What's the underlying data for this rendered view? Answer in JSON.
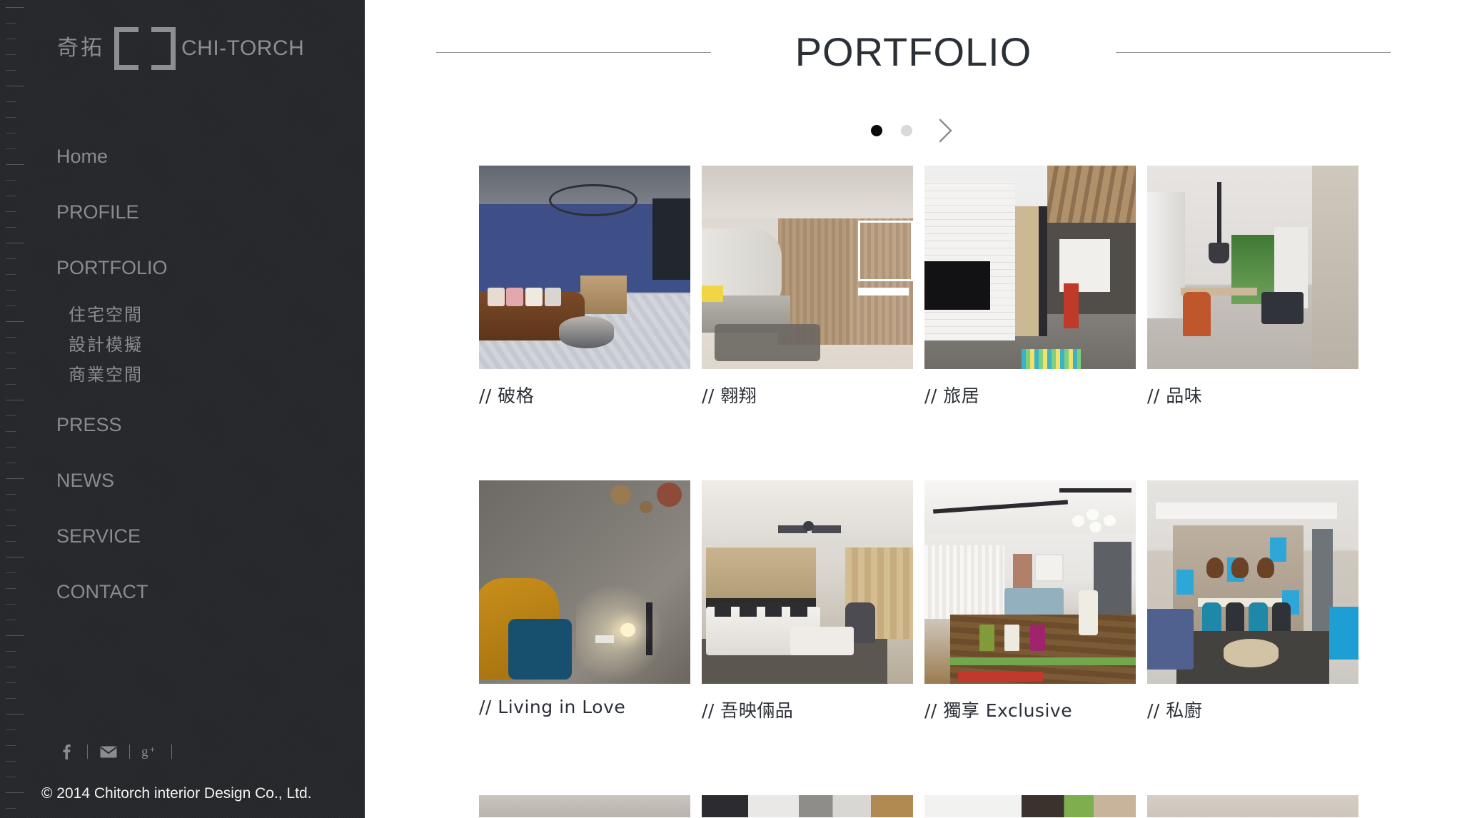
{
  "sidebar": {
    "logo": {
      "cn": "奇拓",
      "en": "CHI-TORCH",
      "bracket_icon": "bracket-logo-icon"
    },
    "nav": [
      {
        "label": "Home",
        "name": "home"
      },
      {
        "label": "PROFILE",
        "name": "profile"
      },
      {
        "label": "PORTFOLIO",
        "name": "portfolio"
      },
      {
        "label": "PRESS",
        "name": "press"
      },
      {
        "label": "NEWS",
        "name": "news"
      },
      {
        "label": "SERVICE",
        "name": "service"
      },
      {
        "label": "CONTACT",
        "name": "contact"
      }
    ],
    "portfolio_sub": [
      {
        "label": "住宅空間",
        "name": "residential"
      },
      {
        "label": "設計模擬",
        "name": "design-simulation"
      },
      {
        "label": "商業空間",
        "name": "commercial"
      }
    ],
    "social": [
      {
        "name": "facebook-icon",
        "glyph": "f"
      },
      {
        "name": "email-icon",
        "glyph": "envelope"
      },
      {
        "name": "google-plus-icon",
        "glyph": "g+"
      }
    ],
    "copyright": "© 2014 Chitorch interior Design Co., Ltd."
  },
  "main": {
    "title": "PORTFOLIO",
    "pagination": {
      "dots": [
        {
          "active": true
        },
        {
          "active": false
        }
      ],
      "next_label": "next-page"
    },
    "rows": [
      {
        "cards": [
          {
            "caption": "// 破格",
            "scene": "s1",
            "alt": "blue wall living room with leather sofa"
          },
          {
            "caption": "// 翱翔",
            "scene": "s2",
            "alt": "wood panelled room with white curved cabinets"
          },
          {
            "caption": "// 旅居",
            "scene": "s3",
            "alt": "white brick wall with tv and wood beams"
          },
          {
            "caption": "// 品味",
            "scene": "s4",
            "alt": "dining nook with orange chair and window"
          }
        ]
      },
      {
        "cards": [
          {
            "caption": "// Living in Love",
            "scene": "s5",
            "alt": "dim room with mustard egg chair"
          },
          {
            "caption": "// 吾映倆品",
            "scene": "s6",
            "alt": "living room with white sectional and ceiling fan"
          },
          {
            "caption": "// 獨享 Exclusive",
            "scene": "s7",
            "alt": "loft with reclaimed wood table and track lights"
          },
          {
            "caption": "// 私廚",
            "scene": "s8",
            "alt": "dining area with teal chairs and blue sofa"
          }
        ]
      }
    ],
    "partial_row": [
      {
        "scene": "p1"
      },
      {
        "scene": "p2"
      },
      {
        "scene": "p3"
      },
      {
        "scene": "p4"
      }
    ]
  },
  "colors": {
    "sidebar_bg": "#28292d",
    "sidebar_text": "#8a8b90",
    "title_text": "#2b2f36",
    "dot_active": "#0a0a0a",
    "dot_inactive": "#d9d9d9",
    "rule": "#8e9196"
  }
}
